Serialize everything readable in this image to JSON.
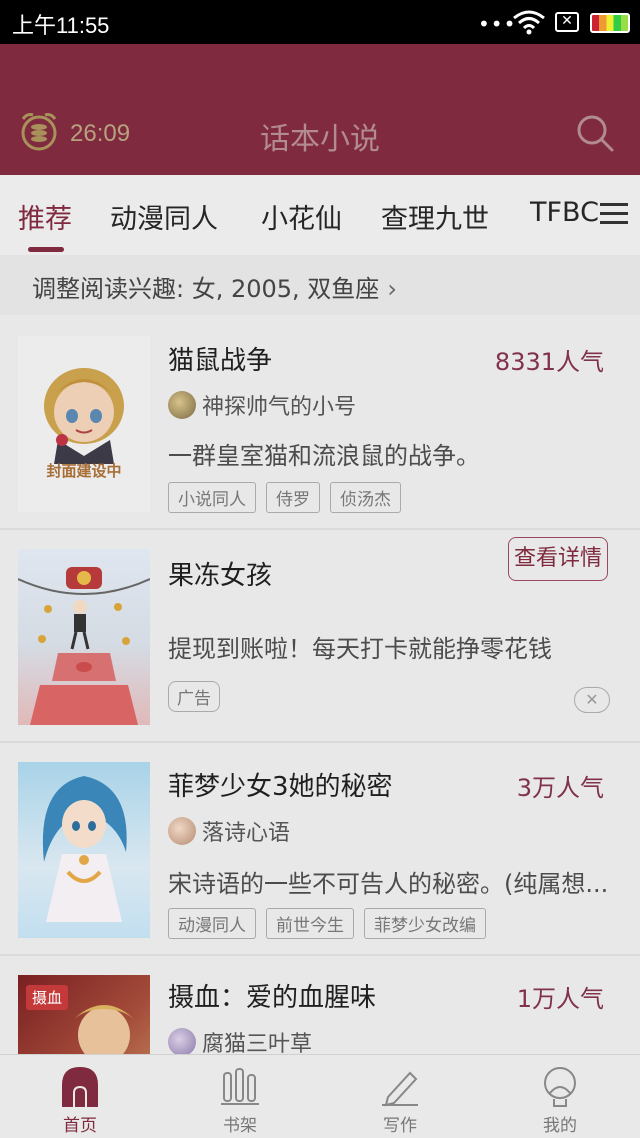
{
  "status_bar": {
    "time": "上午11:55",
    "dots": "•••",
    "sim_icon": "✕"
  },
  "header": {
    "timer": "26:09",
    "title": "话本小说"
  },
  "tabs": [
    "推荐",
    "动漫同人",
    "小花仙",
    "查理九世",
    "TFBC"
  ],
  "interest": {
    "text": "调整阅读兴趣: 女, 2005, 双鱼座",
    "chevron": "›"
  },
  "books": [
    {
      "title": "猫鼠战争",
      "popularity": "8331人气",
      "author": "神探帅气的小号",
      "description": "一群皇室猫和流浪鼠的战争。",
      "tags": [
        "小说同人",
        "侍罗",
        "侦汤杰"
      ],
      "cover_text": "封面建设中"
    },
    {
      "title": "菲梦少女3她的秘密",
      "popularity": "3万人气",
      "author": "落诗心语",
      "description": "宋诗语的一些不可告人的秘密。(纯属想...",
      "tags": [
        "动漫同人",
        "前世今生",
        "菲梦少女改编"
      ]
    },
    {
      "title": "摄血：爱的血腥味",
      "popularity": "1万人气",
      "author": "腐猫三叶草",
      "cover_text": "摄血"
    }
  ],
  "ad": {
    "title": "果冻女孩",
    "button": "查看详情",
    "description": "提现到账啦！每天打卡就能挣零花钱",
    "label": "广告",
    "close": "✕"
  },
  "bottom_nav": [
    "首页",
    "书架",
    "写作",
    "我的"
  ],
  "colors": {
    "accent": "#7f2a3e",
    "header_bg": "#7f2a3e",
    "popularity": "#80324a"
  }
}
